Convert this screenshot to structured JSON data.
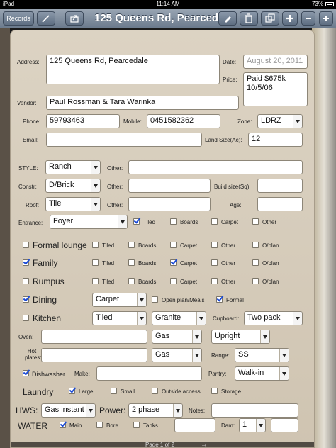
{
  "status": {
    "device": "iPad",
    "time": "11:14 AM",
    "battery": "73%"
  },
  "toolbar": {
    "records_label": "Records",
    "title": "125 Queens Rd, Pearcedale"
  },
  "form": {
    "address_label": "Address:",
    "address_value": "125 Queens Rd, Pearcedale",
    "date_label": "Date:",
    "date_value": "August 20, 2011",
    "price_label": "Price:",
    "price_value": "Paid $675k 10/5/06",
    "vendor_label": "Vendor:",
    "vendor_value": "Paul Rossman & Tara Warinka",
    "phone_label": "Phone:",
    "phone_value": "59793463",
    "mobile_label": "Mobile:",
    "mobile_value": "0451582362",
    "zone_label": "Zone:",
    "zone_value": "LDRZ",
    "email_label": "Email:",
    "email_value": "",
    "land_label": "Land Size(Ac):",
    "land_value": "12",
    "style_label": "STYLE:",
    "style_value": "Ranch",
    "other_label": "Other:",
    "constr_label": "Constr:",
    "constr_value": "D/Brick",
    "build_label": "Build size(Sq):",
    "roof_label": "Roof:",
    "roof_value": "Tile",
    "age_label": "Age:",
    "entrance_label": "Entrance:",
    "entrance_value": "Foyer",
    "tiled": "Tiled",
    "boards": "Boards",
    "carpet": "Carpet",
    "other": "Other",
    "oplan": "O/plan",
    "formal_lounge": "Formal lounge",
    "family": "Family",
    "rumpus": "Rumpus",
    "dining": "Dining",
    "dining_value": "Carpet",
    "open_plan_meals": "Open plan/Meals",
    "formal": "Formal",
    "kitchen": "Kitchen",
    "kitchen_floor": "Tiled",
    "kitchen_bench": "Granite",
    "cupboard_label": "Cupboard:",
    "cupboard_value": "Two pack",
    "oven_label": "Oven:",
    "oven_fuel": "Gas",
    "oven_type": "Upright",
    "hotplates_label": "Hot plates:",
    "hotplates_fuel": "Gas",
    "range_label": "Range:",
    "range_value": "SS",
    "dishwasher": "Dishwasher",
    "make_label": "Make:",
    "pantry_label": "Pantry:",
    "pantry_value": "Walk-in",
    "laundry": "Laundry",
    "large": "Large",
    "small": "Small",
    "outside_access": "Outside access",
    "storage": "Storage",
    "hws_label": "HWS:",
    "hws_value": "Gas instant",
    "power_label": "Power:",
    "power_value": "2 phase",
    "notes_label": "Notes:",
    "water_label": "WATER",
    "main": "Main",
    "bore": "Bore",
    "tanks": "Tanks",
    "dam_label": "Dam:",
    "dam_value": "1"
  },
  "footer": {
    "page": "Page 1 of 2",
    "next_arrow": "→"
  }
}
